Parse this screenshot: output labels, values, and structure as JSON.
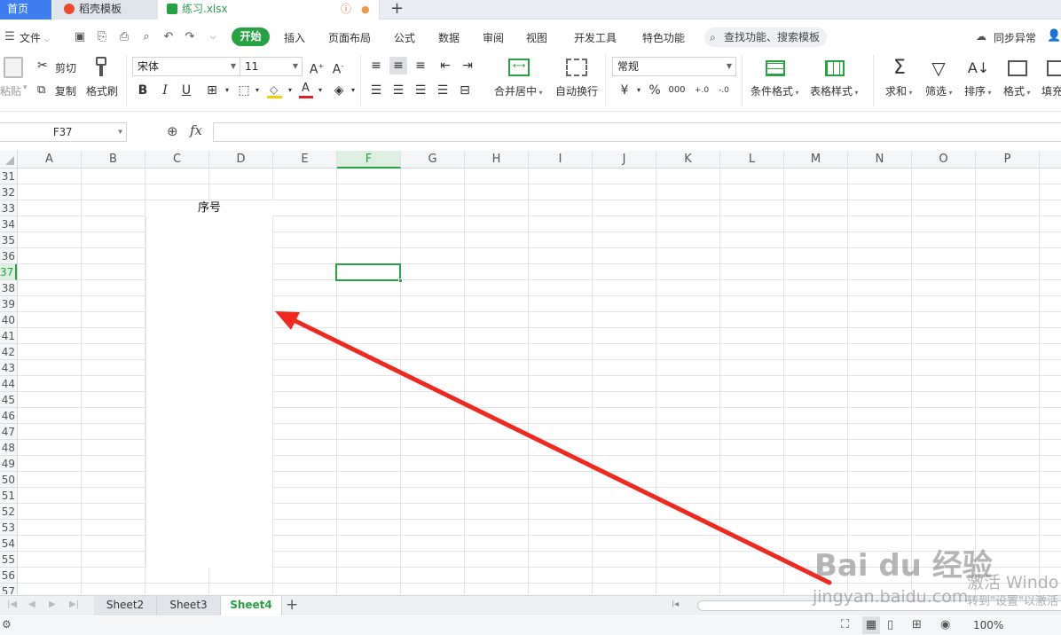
{
  "tabs": {
    "home": "首页",
    "template": "稻壳模板",
    "file": "练习.xlsx",
    "new_tab": "+"
  },
  "menu": {
    "file": "文件",
    "items": [
      "开始",
      "插入",
      "页面布局",
      "公式",
      "数据",
      "审阅",
      "视图",
      "开发工具",
      "特色功能"
    ],
    "search": "查找功能、搜索模板",
    "sync": "同步异常"
  },
  "ribbon": {
    "paste": "粘贴",
    "cut": "剪切",
    "copy": "复制",
    "format_painter": "格式刷",
    "font_name": "宋体",
    "font_size": "11",
    "number_format": "常规",
    "merge_center": "合并居中",
    "wrap_text": "自动换行",
    "conditional_format": "条件格式",
    "table_style": "表格样式",
    "sum": "求和",
    "filter": "筛选",
    "sort": "排序",
    "format": "格式",
    "fill": "填充",
    "bold": "B",
    "italic": "I",
    "underline": "U",
    "currency": "¥",
    "percent": "%",
    "thousands": "000",
    "inc_decimal": "+.0",
    "dec_decimal": "-.0"
  },
  "formula_bar": {
    "name_box": "F37",
    "fx": "fx",
    "formula": ""
  },
  "grid": {
    "columns": [
      "A",
      "B",
      "C",
      "D",
      "E",
      "F",
      "G",
      "H",
      "I",
      "J",
      "K",
      "L",
      "M",
      "N",
      "O",
      "P"
    ],
    "selected_column": "F",
    "rows": [
      "31",
      "32",
      "33",
      "34",
      "35",
      "36",
      "37",
      "38",
      "39",
      "40",
      "41",
      "42",
      "43",
      "44",
      "45",
      "46",
      "47",
      "48",
      "49",
      "50",
      "51",
      "52",
      "53",
      "54",
      "55",
      "56",
      "57"
    ],
    "selected_row": "37",
    "header_cell": "序号"
  },
  "sheets": {
    "tabs": [
      "Sheet2",
      "Sheet3",
      "Sheet4"
    ],
    "active": "Sheet4",
    "add": "+"
  },
  "status": {
    "zoom": "100%"
  },
  "watermark": {
    "brand": "Bai du 经验",
    "url": "jingyan.baidu.com",
    "activate_title": "激活 Windo",
    "activate_sub": "转到\"设置\"以激活"
  },
  "colors": {
    "accent_green": "#27a243",
    "home_tab_blue": "#3d7ff0",
    "arrow_red": "#f0281e"
  }
}
